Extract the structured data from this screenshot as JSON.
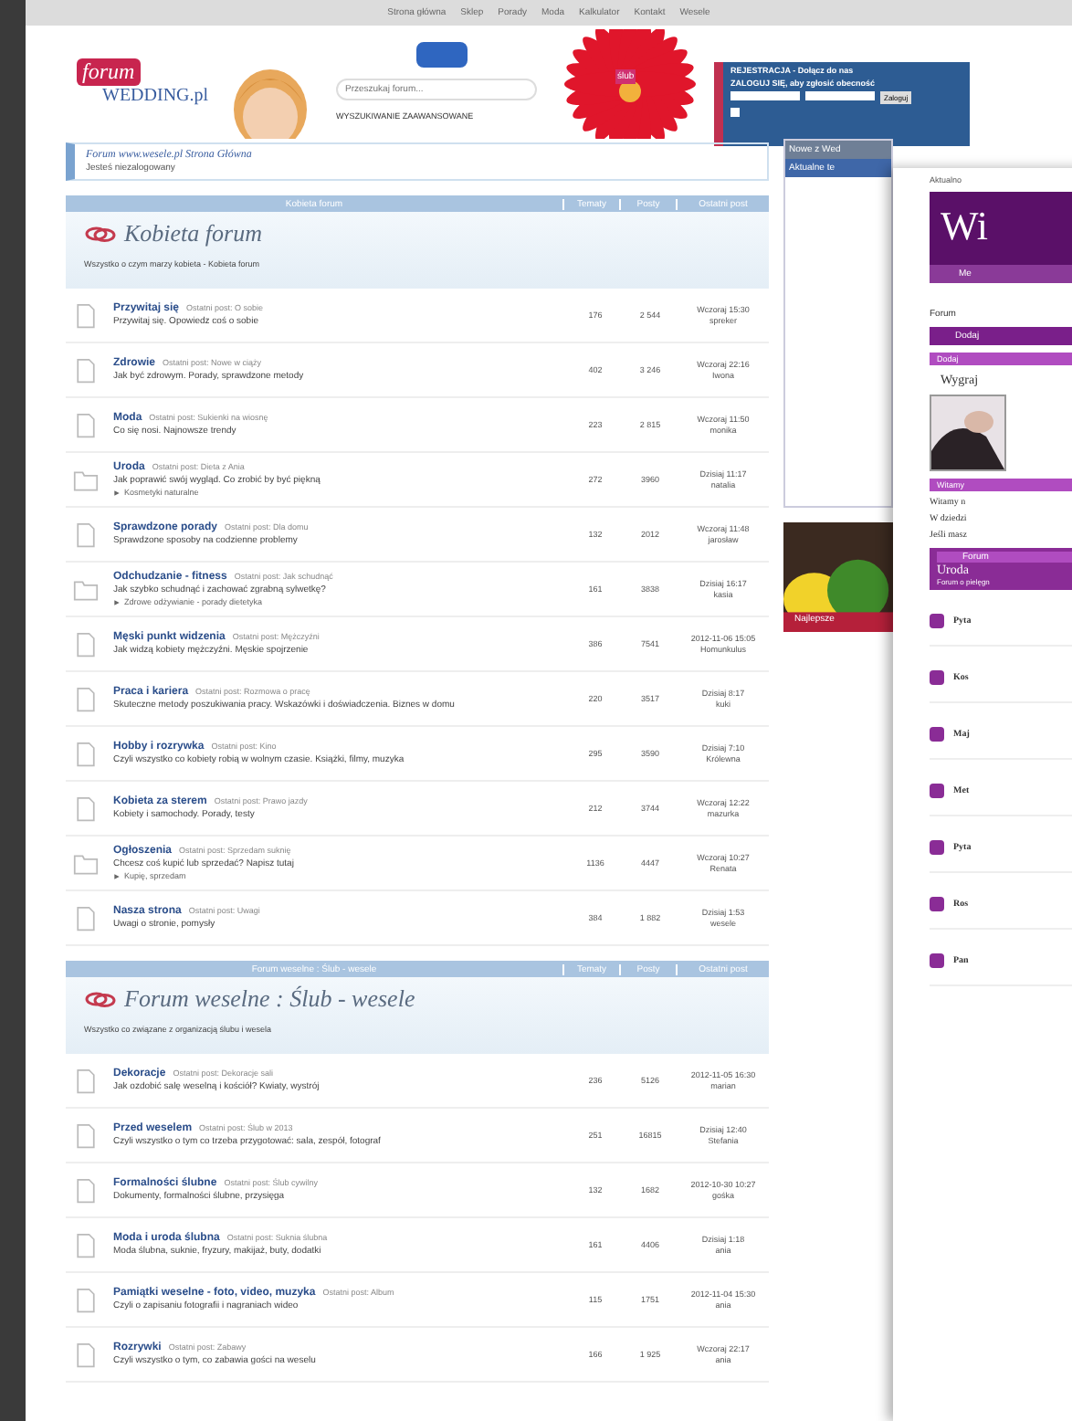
{
  "top_nav": [
    "Strona główna",
    "Sklep",
    "Porady",
    "Moda",
    "Kalkulator",
    "Kontakt",
    "Wesele"
  ],
  "logo": {
    "top": "forum",
    "bottom": "WEDDING.pl"
  },
  "search": {
    "placeholder": "Przeszukaj forum..."
  },
  "header_link": "WYSZUKIWANIE ZAAWANSOWANE",
  "flower_label": "ślub",
  "login": {
    "lines": [
      "REJESTRACJA - Dołącz do nas",
      "ZALOGUJ SIĘ, aby zgłosić obecność"
    ],
    "button": "Zaloguj",
    "remember": false
  },
  "breadcrumb": {
    "title": "Forum www.wesele.pl Strona Główna",
    "subtitle": "Jesteś niezalogowany"
  },
  "sections": [
    {
      "header": "Kobieta forum",
      "columns": [
        "Tematy",
        "Posty",
        "Ostatni post"
      ],
      "title": "Kobieta forum",
      "description": "Wszystko o czym marzy kobieta - Kobieta forum",
      "forums": [
        {
          "kind": "doc",
          "name": "Przywitaj się",
          "moderator": "Ostatni post: O sobie",
          "desc": "Przywitaj się. Opowiedz coś o sobie",
          "topics": "176",
          "posts": "2 544",
          "last": [
            "Wczoraj 15:30",
            "spreker"
          ]
        },
        {
          "kind": "doc",
          "name": "Zdrowie",
          "moderator": "Ostatni post: Nowe w ciąży",
          "desc": "Jak być zdrowym. Porady, sprawdzone metody",
          "topics": "402",
          "posts": "3 246",
          "last": [
            "Wczoraj 22:16",
            "Iwona"
          ]
        },
        {
          "kind": "doc",
          "name": "Moda",
          "moderator": "Ostatni post: Sukienki na wiosnę",
          "desc": "Co się nosi. Najnowsze trendy",
          "topics": "223",
          "posts": "2 815",
          "last": [
            "Wczoraj 11:50",
            "monika"
          ]
        },
        {
          "kind": "folder",
          "name": "Uroda",
          "moderator": "Ostatni post: Dieta z Ania",
          "desc": "Jak poprawić swój wygląd. Co zrobić by być piękną",
          "sub": "Kosmetyki naturalne",
          "topics": "272",
          "posts": "3960",
          "last": [
            "Dzisiaj 11:17",
            "natalia"
          ]
        },
        {
          "kind": "doc",
          "name": "Sprawdzone porady",
          "moderator": "Ostatni post: Dla domu",
          "desc": "Sprawdzone sposoby na codzienne problemy",
          "topics": "132",
          "posts": "2012",
          "last": [
            "Wczoraj 11:48",
            "jarosław"
          ]
        },
        {
          "kind": "folder",
          "name": "Odchudzanie - fitness",
          "moderator": "Ostatni post: Jak schudnąć",
          "desc": "Jak szybko schudnąć i zachować zgrabną sylwetkę?",
          "sub": "Zdrowe odżywianie - porady dietetyka",
          "topics": "161",
          "posts": "3838",
          "last": [
            "Dzisiaj 16:17",
            "kasia"
          ]
        },
        {
          "kind": "doc",
          "name": "Męski punkt widzenia",
          "moderator": "Ostatni post: Mężczyźni",
          "desc": "Jak widzą kobiety mężczyźni. Męskie spojrzenie",
          "topics": "386",
          "posts": "7541",
          "last": [
            "2012-11-06 15:05",
            "Homunkulus"
          ]
        },
        {
          "kind": "doc",
          "name": "Praca i kariera",
          "moderator": "Ostatni post: Rozmowa o pracę",
          "desc": "Skuteczne metody poszukiwania pracy. Wskazówki i doświadczenia. Biznes w domu",
          "topics": "220",
          "posts": "3517",
          "last": [
            "Dzisiaj 8:17",
            "kuki"
          ]
        },
        {
          "kind": "doc",
          "name": "Hobby i rozrywka",
          "moderator": "Ostatni post: Kino",
          "desc": "Czyli wszystko co kobiety robią w wolnym czasie. Książki, filmy, muzyka",
          "topics": "295",
          "posts": "3590",
          "last": [
            "Dzisiaj 7:10",
            "Królewna"
          ]
        },
        {
          "kind": "doc",
          "name": "Kobieta za sterem",
          "moderator": "Ostatni post: Prawo jazdy",
          "desc": "Kobiety i samochody. Porady, testy",
          "topics": "212",
          "posts": "3744",
          "last": [
            "Wczoraj 12:22",
            "mazurka"
          ]
        },
        {
          "kind": "folder",
          "name": "Ogłoszenia",
          "moderator": "Ostatni post: Sprzedam suknię",
          "desc": "Chcesz coś kupić lub sprzedać? Napisz tutaj",
          "sub": "Kupię, sprzedam",
          "topics": "1136",
          "posts": "4447",
          "last": [
            "Wczoraj 10:27",
            "Renata"
          ]
        },
        {
          "kind": "doc",
          "name": "Nasza strona",
          "moderator": "Ostatni post: Uwagi",
          "desc": "Uwagi o stronie, pomysły",
          "topics": "384",
          "posts": "1 882",
          "last": [
            "Dzisiaj 1:53",
            "wesele"
          ]
        }
      ]
    },
    {
      "header": "Forum weselne : Ślub - wesele",
      "columns": [
        "Tematy",
        "Posty",
        "Ostatni post"
      ],
      "title": "Forum weselne : Ślub - wesele",
      "description": "Wszystko co związane z organizacją ślubu i wesela",
      "forums": [
        {
          "kind": "doc",
          "name": "Dekoracje",
          "moderator": "Ostatni post: Dekoracje sali",
          "desc": "Jak ozdobić salę weselną i kościół? Kwiaty, wystrój",
          "topics": "236",
          "posts": "5126",
          "last": [
            "2012-11-05 16:30",
            "marian"
          ]
        },
        {
          "kind": "doc",
          "name": "Przed weselem",
          "moderator": "Ostatni post: Ślub w 2013",
          "desc": "Czyli wszystko o tym co trzeba przygotować: sala, zespół, fotograf",
          "topics": "251",
          "posts": "16815",
          "last": [
            "Dzisiaj 12:40",
            "Stefania"
          ]
        },
        {
          "kind": "doc",
          "name": "Formalności ślubne",
          "moderator": "Ostatni post: Ślub cywilny",
          "desc": "Dokumenty, formalności ślubne, przysięga",
          "topics": "132",
          "posts": "1682",
          "last": [
            "2012-10-30 10:27",
            "gośka"
          ]
        },
        {
          "kind": "doc",
          "name": "Moda i uroda ślubna",
          "moderator": "Ostatni post: Suknia ślubna",
          "desc": "Moda ślubna, suknie, fryzury, makijaż, buty, dodatki",
          "topics": "161",
          "posts": "4406",
          "last": [
            "Dzisiaj 1:18",
            "ania"
          ]
        },
        {
          "kind": "doc",
          "name": "Pamiątki weselne - foto, video, muzyka",
          "moderator": "Ostatni post: Album",
          "desc": "Czyli o zapisaniu fotografii i nagraniach wideo",
          "topics": "115",
          "posts": "1751",
          "last": [
            "2012-11-04 15:30",
            "ania"
          ]
        },
        {
          "kind": "doc",
          "name": "Rozrywki",
          "moderator": "Ostatni post: Zabawy",
          "desc": "Czyli wszystko o tym, co zabawia gości na weselu",
          "topics": "166",
          "posts": "1 925",
          "last": [
            "Wczoraj 22:17",
            "ania"
          ]
        }
      ]
    }
  ],
  "sidebar": {
    "title": "Nowe z Wed",
    "subtitle": "Aktualne te",
    "ad_label": "Najlepsze"
  },
  "overlay": {
    "crumb": "Aktualno",
    "banner": "Wi",
    "nav": "Me",
    "path": "Forum",
    "button": "Dodaj",
    "box_title": "Dodaj",
    "teaser": "Wygraj",
    "welcome_title": "Witamy",
    "welcome": "Witamy n",
    "para": "W dziedzi",
    "note": "Jeśli masz",
    "table_header": "Forum",
    "table_title": "Uroda",
    "table_sub": "Forum o pielęgn",
    "rows": [
      "Pyta",
      "Kos",
      "Maj",
      "Met",
      "Pyta",
      "Ros",
      "Pan"
    ]
  }
}
